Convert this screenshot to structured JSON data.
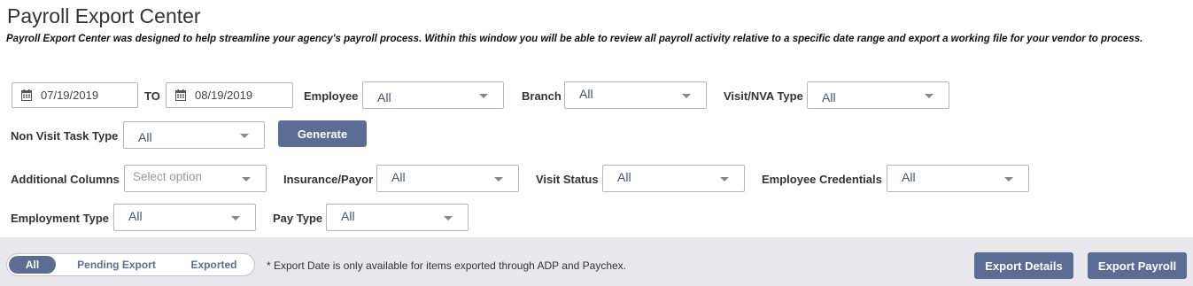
{
  "page": {
    "title": "Payroll Export Center",
    "description": "Payroll Export Center was designed to help streamline your agency's payroll process. Within this window you will be able to review all payroll activity relative to a specific date range and export a working file for your vendor to process."
  },
  "filters": {
    "date_from": "07/19/2019",
    "to_label": "TO",
    "date_to": "08/19/2019",
    "employee": {
      "label": "Employee",
      "value": "All"
    },
    "branch": {
      "label": "Branch",
      "value": "All"
    },
    "visit_nva_type": {
      "label": "Visit/NVA Type",
      "value": "All"
    },
    "non_visit_task_type": {
      "label": "Non Visit Task Type",
      "value": "All"
    },
    "generate_label": "Generate",
    "additional_columns": {
      "label": "Additional Columns",
      "placeholder": "Select option"
    },
    "insurance_payor": {
      "label": "Insurance/Payor",
      "value": "All"
    },
    "visit_status": {
      "label": "Visit Status",
      "value": "All"
    },
    "employee_credentials": {
      "label": "Employee Credentials",
      "value": "All"
    },
    "employment_type": {
      "label": "Employment Type",
      "value": "All"
    },
    "pay_type": {
      "label": "Pay Type",
      "value": "All"
    }
  },
  "bottom_bar": {
    "tabs": [
      {
        "label": "All",
        "active": true
      },
      {
        "label": "Pending Export",
        "active": false
      },
      {
        "label": "Exported",
        "active": false
      }
    ],
    "note": "* Export Date is only available for items exported through ADP and Paychex.",
    "export_details_label": "Export Details",
    "export_payroll_label": "Export Payroll"
  },
  "colors": {
    "accent": "#5b6d95",
    "bar_background": "#e8e8ec",
    "select_text": "#44546a"
  },
  "icons": {
    "date_field": "calendar-icon",
    "select": "chevron-down-icon"
  }
}
